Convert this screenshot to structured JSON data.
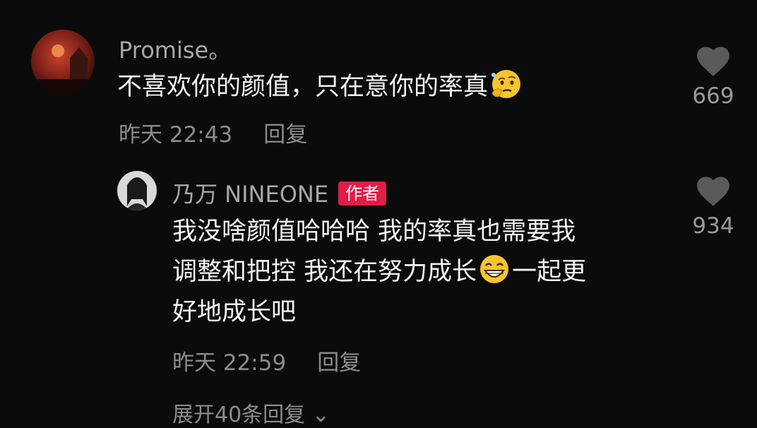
{
  "comments": [
    {
      "username": "Promise。",
      "text_before_emoji": "不喜欢你的颜值，只在意你的率真",
      "emoji": "thinking-face-emoji",
      "time": "昨天 22:43",
      "reply_label": "回复",
      "likes": "669"
    }
  ],
  "reply": {
    "username": "乃万 NINEONE",
    "author_badge": "作者",
    "line1": "我没啥颜值哈哈哈 我的率真也需要我",
    "line2_before_emoji": "调整和把控 我还在努力成长",
    "emoji": "grinning-face-emoji",
    "line2_after_emoji": "一起更",
    "line3": "好地成长吧",
    "time": "昨天 22:59",
    "reply_label": "回复",
    "likes": "934"
  },
  "expand_label": "展开40条回复 ⌄",
  "colors": {
    "background": "#0b0b0b",
    "badge": "#e11d48",
    "muted": "#8c8c8c"
  }
}
